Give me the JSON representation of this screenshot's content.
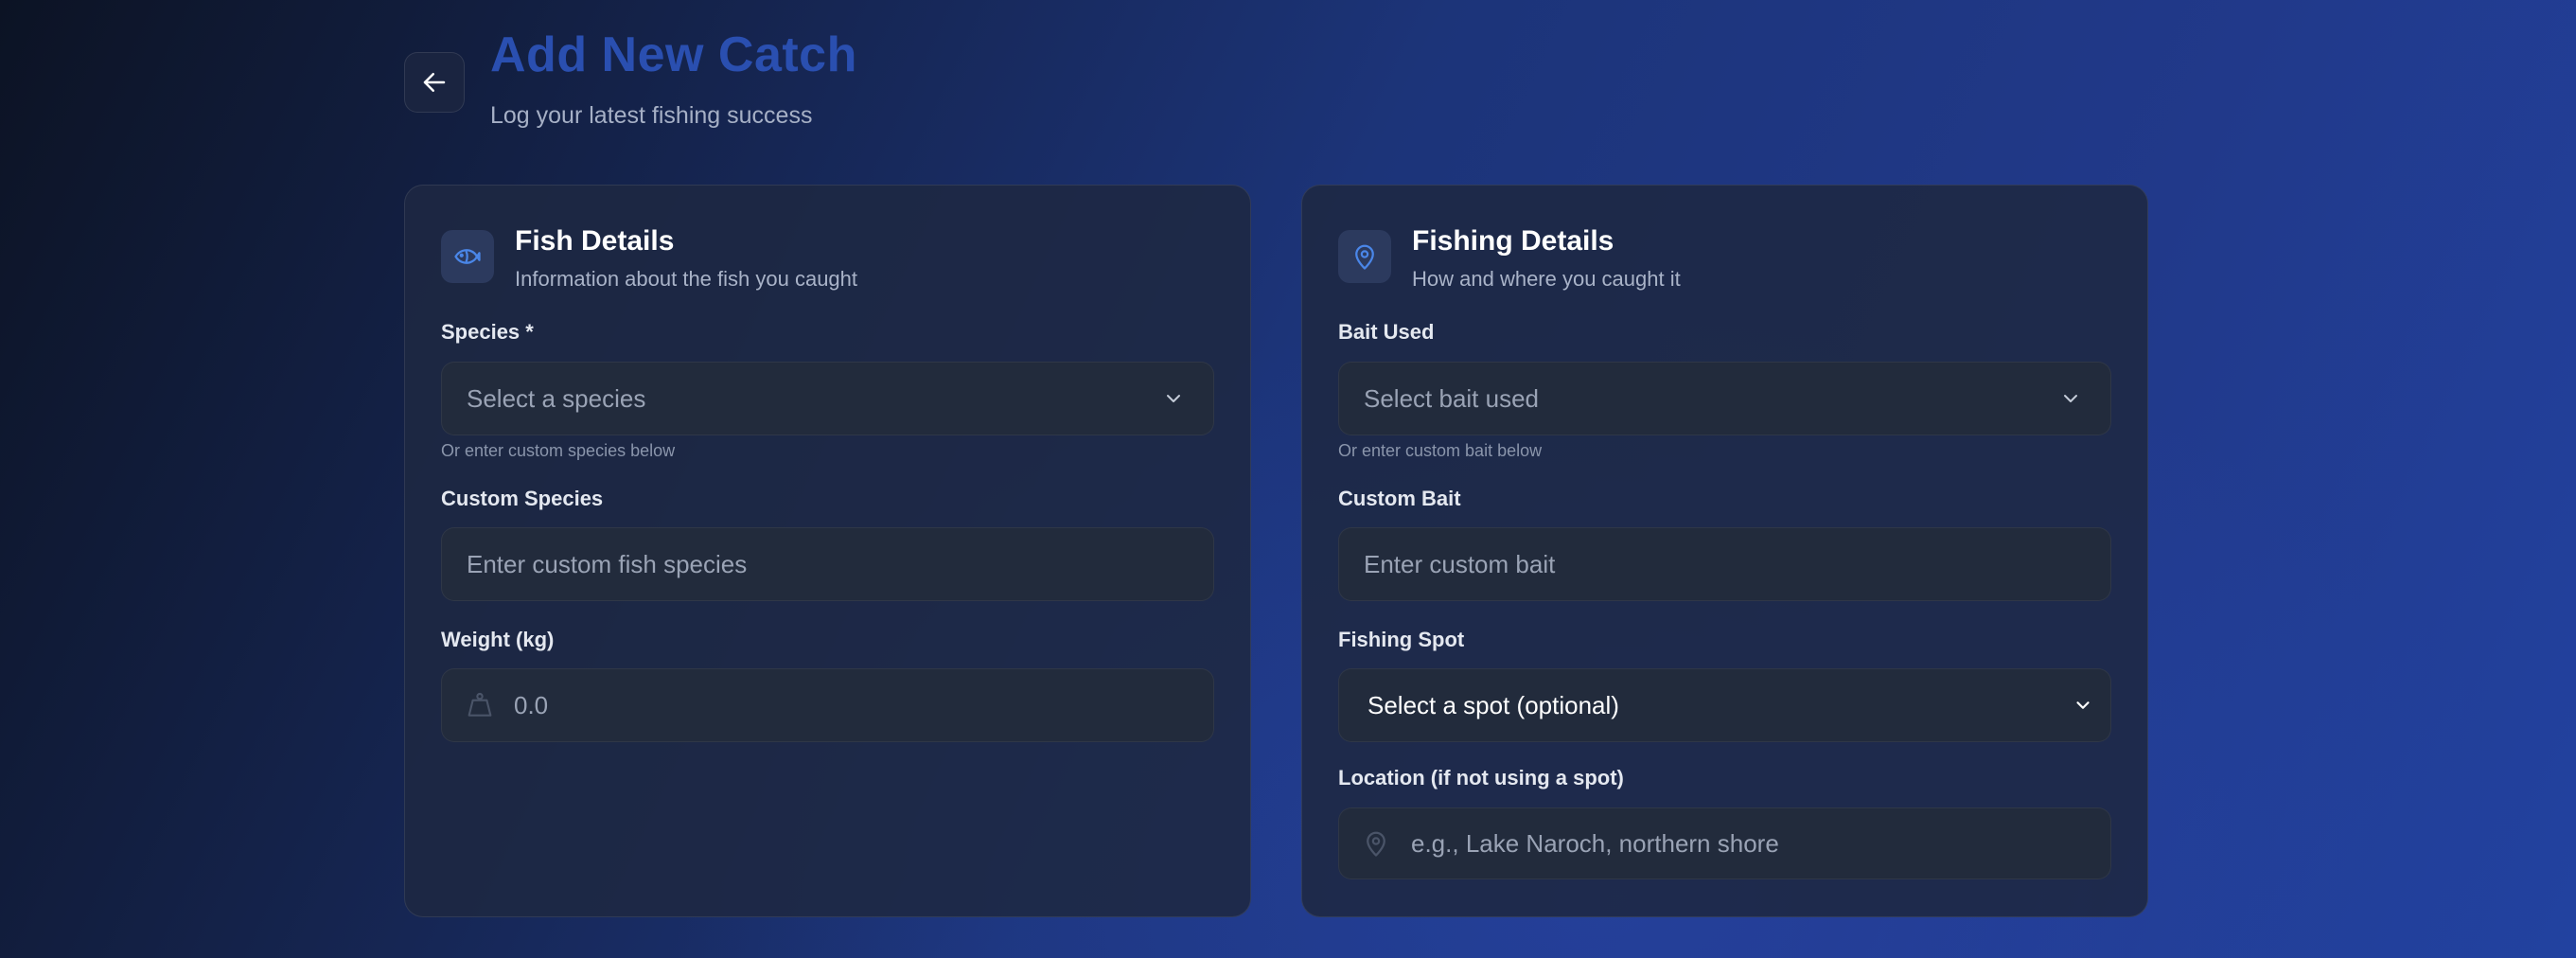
{
  "header": {
    "title": "Add New Catch",
    "subtitle": "Log your latest fishing success"
  },
  "fish_card": {
    "title": "Fish Details",
    "description": "Information about the fish you caught",
    "species_label": "Species *",
    "species_placeholder": "Select a species",
    "species_hint": "Or enter custom species below",
    "custom_species_label": "Custom Species",
    "custom_species_placeholder": "Enter custom fish species",
    "weight_label": "Weight (kg)",
    "weight_placeholder": "0.0"
  },
  "fishing_card": {
    "title": "Fishing Details",
    "description": "How and where you caught it",
    "bait_label": "Bait Used",
    "bait_placeholder": "Select bait used",
    "bait_hint": "Or enter custom bait below",
    "custom_bait_label": "Custom Bait",
    "custom_bait_placeholder": "Enter custom bait",
    "spot_label": "Fishing Spot",
    "spot_value": "Select a spot (optional)",
    "location_label": "Location (if not using a spot)",
    "location_placeholder": "e.g., Lake Naroch, northern shore"
  },
  "icons": {
    "back": "arrow-left-icon",
    "fish": "fish-icon",
    "map_pin": "map-pin-icon",
    "weight": "weight-icon",
    "chevron": "chevron-down-icon"
  },
  "colors": {
    "title_accent": "#2a4fb0",
    "icon_accent": "#4a86e8"
  }
}
